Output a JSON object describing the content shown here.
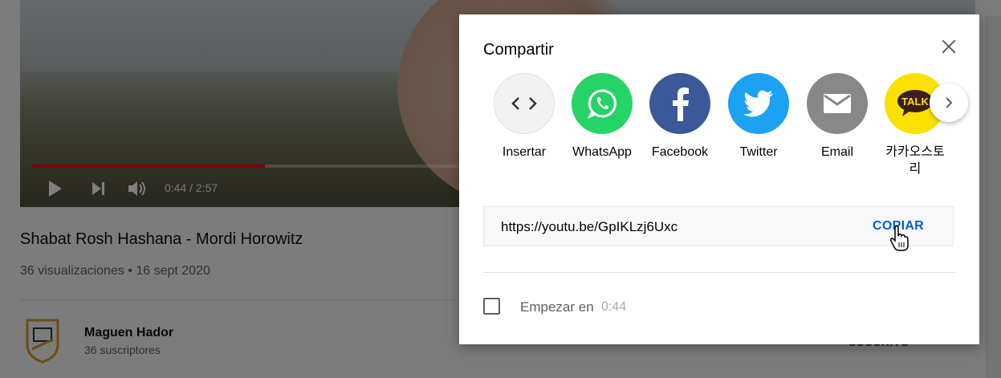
{
  "player": {
    "time": "0:44 / 2:57",
    "progress_fraction": 0.25
  },
  "video": {
    "title": "Shabat Rosh Hashana - Mordi Horowitz",
    "meta": "36 visualizaciones • 16 sept 2020"
  },
  "channel": {
    "name": "Maguen Hador",
    "subscribers": "36 suscriptores",
    "subscribe_label": "SUSCRITO"
  },
  "share": {
    "title": "Compartir",
    "targets": [
      {
        "label": "Insertar",
        "icon": "embed-icon"
      },
      {
        "label": "WhatsApp",
        "icon": "whatsapp-icon"
      },
      {
        "label": "Facebook",
        "icon": "facebook-icon"
      },
      {
        "label": "Twitter",
        "icon": "twitter-icon"
      },
      {
        "label": "Email",
        "icon": "email-icon"
      },
      {
        "label": "카카오스토리",
        "icon": "kakaotalk-icon",
        "badge": "TALK"
      }
    ],
    "url": "https://youtu.be/GpIKLzj6Uxc",
    "copy_label": "COPIAR",
    "start_label": "Empezar en",
    "start_time": "0:44"
  },
  "colors": {
    "whatsapp": "#25d366",
    "facebook": "#3b5998",
    "twitter": "#1da1f2",
    "email": "#888888",
    "kakao": "#fae100",
    "link": "#065fd4",
    "progress": "#ff0000"
  }
}
